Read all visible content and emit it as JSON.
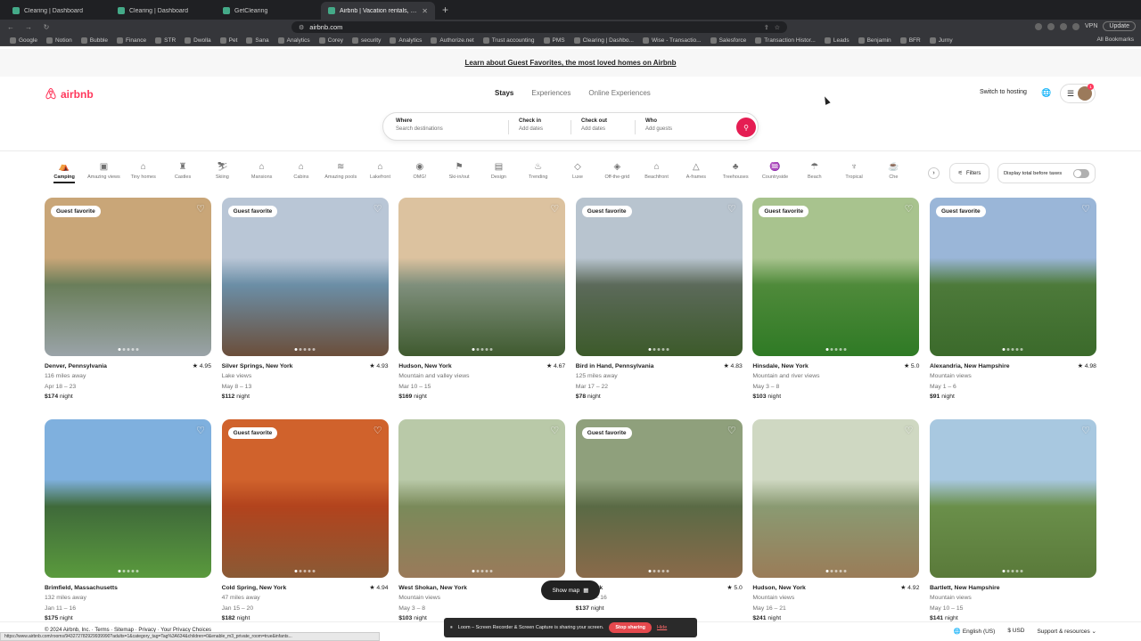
{
  "browser": {
    "tabs": [
      {
        "label": "Clearing | Dashboard",
        "active": false
      },
      {
        "label": "Clearing | Dashboard",
        "active": false
      },
      {
        "label": "GetClearing",
        "active": false
      },
      {
        "label": "Airbnb | Vacation rentals, cab",
        "active": true
      }
    ],
    "url": "airbnb.com",
    "vpn_label": "VPN",
    "update_label": "Update",
    "bookmarks": [
      "Google",
      "Notion",
      "Bubble",
      "Finance",
      "STR",
      "Dwolla",
      "Pet",
      "Sana",
      "Analytics",
      "Corey",
      "security",
      "Analytics",
      "Authorize.net",
      "Trust accounting",
      "PMS",
      "Clearing | Dashbo...",
      "Wise - Transactio...",
      "Salesforce",
      "Transaction Histor...",
      "Leads",
      "Benjamin",
      "BFR",
      "Jurny"
    ],
    "all_bookmarks": "All Bookmarks"
  },
  "banner": {
    "text": "Learn about Guest Favorites, the most loved homes on Airbnb"
  },
  "header": {
    "logo": "airbnb",
    "nav": [
      "Stays",
      "Experiences",
      "Online Experiences"
    ],
    "switch_hosting": "Switch to hosting",
    "notification_count": "1"
  },
  "search": {
    "where_label": "Where",
    "where_placeholder": "Search destinations",
    "checkin_label": "Check in",
    "checkin_placeholder": "Add dates",
    "checkout_label": "Check out",
    "checkout_placeholder": "Add dates",
    "who_label": "Who",
    "who_placeholder": "Add guests"
  },
  "categories": [
    {
      "label": "Camping",
      "icon": "tent-icon"
    },
    {
      "label": "Amazing views",
      "icon": "view-icon"
    },
    {
      "label": "Tiny homes",
      "icon": "tiny-home-icon"
    },
    {
      "label": "Castles",
      "icon": "castle-icon"
    },
    {
      "label": "Skiing",
      "icon": "ski-icon"
    },
    {
      "label": "Mansions",
      "icon": "mansion-icon"
    },
    {
      "label": "Cabins",
      "icon": "cabin-icon"
    },
    {
      "label": "Amazing pools",
      "icon": "pool-icon"
    },
    {
      "label": "Lakefront",
      "icon": "lake-icon"
    },
    {
      "label": "OMG!",
      "icon": "omg-icon"
    },
    {
      "label": "Ski-in/out",
      "icon": "ski-lift-icon"
    },
    {
      "label": "Design",
      "icon": "design-icon"
    },
    {
      "label": "Trending",
      "icon": "flame-icon"
    },
    {
      "label": "Luxe",
      "icon": "luxe-icon"
    },
    {
      "label": "Off-the-grid",
      "icon": "off-grid-icon"
    },
    {
      "label": "Beachfront",
      "icon": "beachfront-icon"
    },
    {
      "label": "A-frames",
      "icon": "a-frame-icon"
    },
    {
      "label": "Treehouses",
      "icon": "treehouse-icon"
    },
    {
      "label": "Countryside",
      "icon": "countryside-icon"
    },
    {
      "label": "Beach",
      "icon": "umbrella-icon"
    },
    {
      "label": "Tropical",
      "icon": "palm-icon"
    },
    {
      "label": "Che",
      "icon": "chef-icon"
    }
  ],
  "active_category": "Camping",
  "filters_label": "Filters",
  "taxes_label": "Display total before taxes",
  "guest_favorite_label": "Guest favorite",
  "listings": [
    {
      "location": "Denver, Pennsylvania",
      "rating": "4.95",
      "line1": "116 miles away",
      "dates": "Apr 18 – 23",
      "price": "$174",
      "unit": "night",
      "gf": true,
      "colors": [
        "#c9a678",
        "#6a7e5a",
        "#9aa3a8"
      ]
    },
    {
      "location": "Silver Springs, New York",
      "rating": "4.93",
      "line1": "Lake views",
      "dates": "May 8 – 13",
      "price": "$112",
      "unit": "night",
      "gf": true,
      "colors": [
        "#b9c6d6",
        "#6b8ea6",
        "#6b4e3a"
      ]
    },
    {
      "location": "Hudson, New York",
      "rating": "4.67",
      "line1": "Mountain and valley views",
      "dates": "Mar 10 – 15",
      "price": "$169",
      "unit": "night",
      "gf": false,
      "colors": [
        "#dcc29f",
        "#7f8f7c",
        "#3f5a2f"
      ]
    },
    {
      "location": "Bird in Hand, Pennsylvania",
      "rating": "4.83",
      "line1": "125 miles away",
      "dates": "Mar 17 – 22",
      "price": "$78",
      "unit": "night",
      "gf": true,
      "colors": [
        "#b8c4cf",
        "#5c6a5a",
        "#3c5a2a"
      ]
    },
    {
      "location": "Hinsdale, New York",
      "rating": "5.0",
      "line1": "Mountain and river views",
      "dates": "May 3 – 8",
      "price": "$103",
      "unit": "night",
      "gf": true,
      "colors": [
        "#a8c38e",
        "#4f8a3a",
        "#2f7a25"
      ]
    },
    {
      "location": "Alexandria, New Hampshire",
      "rating": "4.98",
      "line1": "Mountain views",
      "dates": "May 1 – 6",
      "price": "$91",
      "unit": "night",
      "gf": true,
      "colors": [
        "#9ab6d8",
        "#4d7a3a",
        "#3b6a2b"
      ]
    },
    {
      "location": "Brimfield, Massachusetts",
      "rating": "",
      "line1": "132 miles away",
      "dates": "Jan 11 – 16",
      "price": "$175",
      "unit": "night",
      "gf": false,
      "colors": [
        "#7fb0de",
        "#3f6a3a",
        "#5a9a3d"
      ]
    },
    {
      "location": "Cold Spring, New York",
      "rating": "4.94",
      "line1": "47 miles away",
      "dates": "Jan 15 – 20",
      "price": "$182",
      "unit": "night",
      "gf": true,
      "colors": [
        "#d0622c",
        "#b2431d",
        "#8a5a35"
      ]
    },
    {
      "location": "West Shokan, New York",
      "rating": "",
      "line1": "Mountain views",
      "dates": "May 3 – 8",
      "price": "$103",
      "unit": "night",
      "gf": false,
      "colors": [
        "#b9c9a8",
        "#7a8a5a",
        "#9a7a5a"
      ]
    },
    {
      "location": "New York",
      "rating": "5.0",
      "line1": "",
      "dates": "Jan 11 – 16",
      "price": "$137",
      "unit": "night",
      "gf": true,
      "colors": [
        "#8fa07c",
        "#5a6a45",
        "#8a6a4a"
      ]
    },
    {
      "location": "Hudson, New York",
      "rating": "4.92",
      "line1": "Mountain views",
      "dates": "May 16 – 21",
      "price": "$241",
      "unit": "night",
      "gf": false,
      "colors": [
        "#cfd8c2",
        "#8a9a72",
        "#9a7c58"
      ]
    },
    {
      "location": "Bartlett, New Hampshire",
      "rating": "",
      "line1": "Mountain views",
      "dates": "May 10 – 15",
      "price": "$141",
      "unit": "night",
      "gf": false,
      "colors": [
        "#a8c8e0",
        "#6a8f4a",
        "#5a7a3a"
      ]
    }
  ],
  "show_map_label": "Show map",
  "footer": {
    "left": "© 2024 Airbnb, Inc. · Terms · Sitemap · Privacy · Your Privacy Choices",
    "language": "English (US)",
    "currency": "$ USD",
    "support": "Support & resources"
  },
  "status_url": "https://www.airbnb.com/rooms/943272782929939990?adults=1&category_tag=Tag%3A634&children=0&enable_m3_private_room=true&infants...",
  "loom": {
    "message": "Loom – Screen Recorder & Screen Capture is sharing your screen.",
    "stop_label": "Stop sharing",
    "hide_label": "Hide"
  },
  "colors": {
    "brand": "#ff385c",
    "search_button": "#e51d53"
  }
}
